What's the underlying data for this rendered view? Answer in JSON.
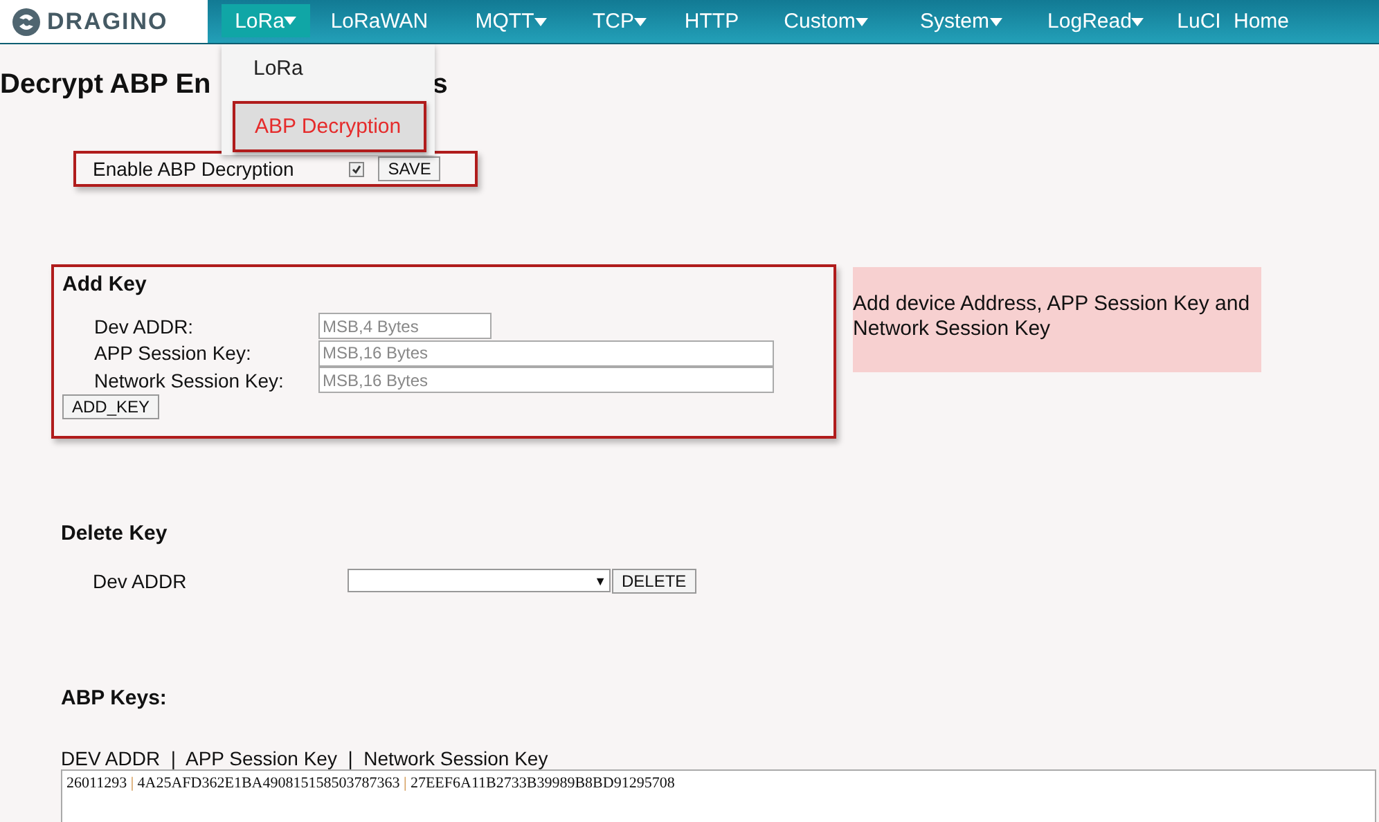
{
  "logo": {
    "text": "DRAGINO"
  },
  "nav": [
    {
      "label": "LoRa",
      "caret": true,
      "selected": true
    },
    {
      "label": "LoRaWAN",
      "caret": false,
      "selected": false
    },
    {
      "label": "MQTT",
      "caret": true,
      "selected": false
    },
    {
      "label": "TCP",
      "caret": true,
      "selected": false
    },
    {
      "label": "HTTP",
      "caret": false,
      "selected": false
    },
    {
      "label": "Custom",
      "caret": true,
      "selected": false
    },
    {
      "label": "System",
      "caret": true,
      "selected": false
    },
    {
      "label": "LogRead",
      "caret": true,
      "selected": false
    },
    {
      "label": "LuCI",
      "caret": false,
      "selected": false
    },
    {
      "label": "Home",
      "caret": false,
      "selected": false
    }
  ],
  "dropdown": [
    {
      "label": "LoRa",
      "selected": false
    },
    {
      "label": "ABP Decryption",
      "selected": true
    }
  ],
  "heading": {
    "visible": "Decrypt ABP En",
    "tail": "s"
  },
  "enable": {
    "label": "Enable ABP Decryption",
    "checked": true,
    "button": "SAVE"
  },
  "add_key": {
    "title": "Add Key",
    "fields": [
      {
        "label": "Dev ADDR:",
        "placeholder": "MSB,4 Bytes",
        "kind": "short"
      },
      {
        "label": "APP Session Key:",
        "placeholder": "MSB,16 Bytes",
        "kind": "long"
      },
      {
        "label": "Network Session Key:",
        "placeholder": "MSB,16 Bytes",
        "kind": "long"
      }
    ],
    "button": "ADD_KEY"
  },
  "note": "Add device Address, APP Session Key and Network Session Key",
  "delete_key": {
    "title": "Delete Key",
    "label": "Dev ADDR",
    "arrow": "▼",
    "button": "DELETE"
  },
  "abp_keys": {
    "title": "ABP Keys:",
    "separator": "|",
    "header": "DEV ADDR  |  APP Session Key  |  Network Session Key",
    "rows": [
      [
        "26011293",
        "4A25AFD362E1BA490815158503787363",
        "27EEF6A11B2733B39989B8BD91295708"
      ]
    ]
  }
}
